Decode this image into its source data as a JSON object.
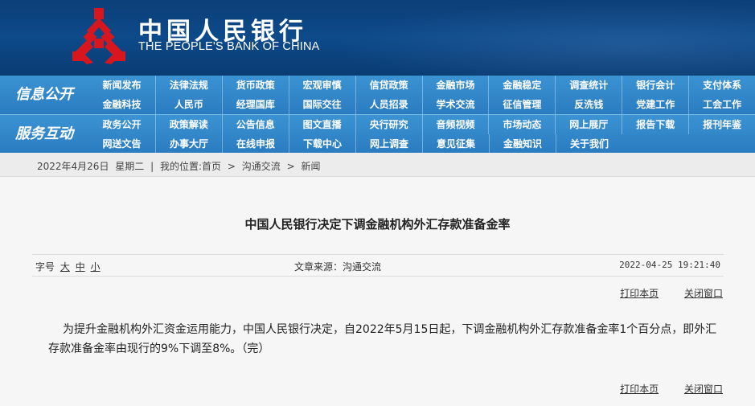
{
  "header": {
    "title_cn": "中国人民银行",
    "title_en": "THE PEOPLE'S BANK OF CHINA",
    "logo_icon": "pboc-emblem-icon",
    "brand_colors": {
      "header_bg": "#0d4a8a",
      "logo_red": "#d8161d",
      "nav_blue": "#2d84c8"
    }
  },
  "nav": {
    "group1_label": "信息公开",
    "group2_label": "服务互动",
    "group1_row1": [
      "新闻发布",
      "法律法规",
      "货币政策",
      "宏观审慎",
      "信贷政策",
      "金融市场",
      "金融稳定",
      "调查统计",
      "银行会计",
      "支付体系"
    ],
    "group1_row2": [
      "金融科技",
      "人民币",
      "经理国库",
      "国际交往",
      "人员招录",
      "学术交流",
      "征信管理",
      "反洗钱",
      "党建工作",
      "工会工作"
    ],
    "group2_row1": [
      "政务公开",
      "政策解读",
      "公告信息",
      "图文直播",
      "央行研究",
      "音频视频",
      "市场动态",
      "网上展厅",
      "报告下载",
      "报刊年鉴"
    ],
    "group2_row2": [
      "网送文告",
      "办事大厅",
      "在线申报",
      "下载中心",
      "网上调查",
      "意见征集",
      "金融知识",
      "关于我们"
    ]
  },
  "breadcrumb": {
    "date": "2022年4月26日",
    "weekday": "星期二",
    "separator": "|",
    "location_label": "我的位置:",
    "home": "首页",
    "arrow": ">",
    "section": "沟通交流",
    "current": "新闻"
  },
  "article": {
    "title": "中国人民银行决定下调金融机构外汇存款准备金率",
    "font_size_label": "字号",
    "font_large": "大",
    "font_medium": "中",
    "font_small": "小",
    "source": "文章来源：沟通交流",
    "datetime": "2022-04-25  19:21:40",
    "print_label": "打印本页",
    "close_label": "关闭窗口",
    "body": "为提升金融机构外汇资金运用能力，中国人民银行决定，自2022年5月15日起，下调金融机构外汇存款准备金率1个百分点，即外汇存款准备金率由现行的9%下调至8%。（完）"
  }
}
